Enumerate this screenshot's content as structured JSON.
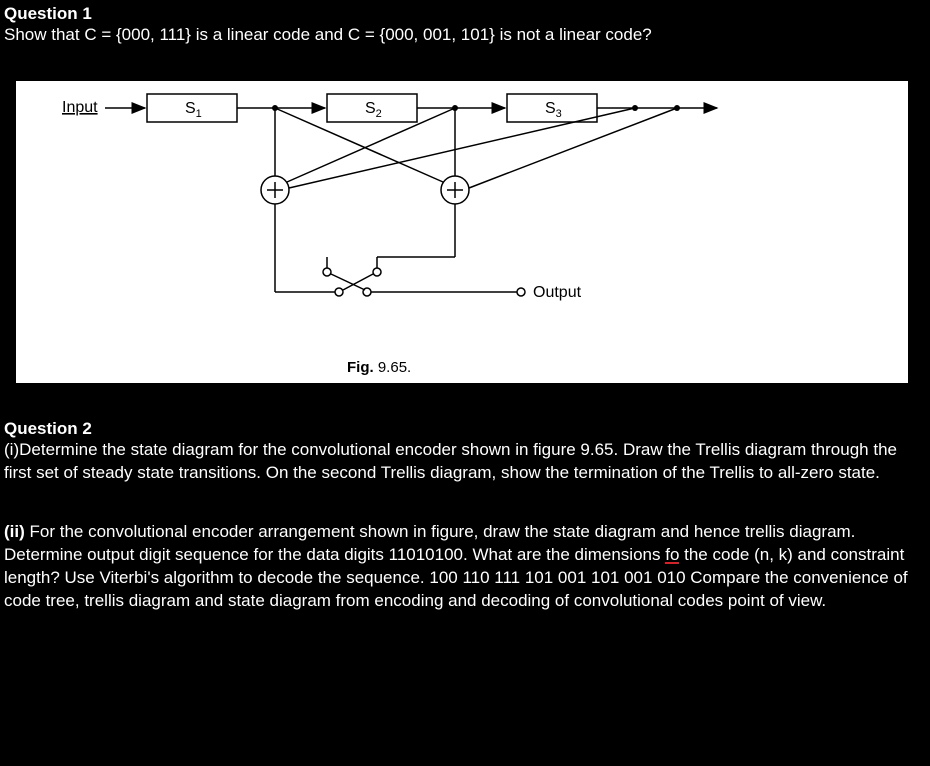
{
  "q1": {
    "title": "Question 1",
    "body": "Show that C = {000, 111} is a linear code and C = {000, 001, 101} is not a linear code?"
  },
  "fig": {
    "input": "Input",
    "s1": "S",
    "s1sub": "1",
    "s2": "S",
    "s2sub": "2",
    "s3": "S",
    "s3sub": "3",
    "output": "Output",
    "caption_b": "Fig.",
    "caption_n": " 9.65."
  },
  "q2": {
    "title": "Question 2",
    "part_i_pre": "(i)",
    "part_i": "Determine the state diagram for the convolutional encoder shown in figure 9.65.  Draw the Trellis diagram through the first set of steady state transitions. On the second Trellis  diagram, show the termination of the Trellis to all-zero state.",
    "part_ii_pre": "(ii)",
    "part_ii_a": " For the convolutional encoder  arrangement shown in figure, draw the state  diagram and hence trellis diagram. Determine output  digit sequence for the data digits 11010100. What are  the dimensions ",
    "part_ii_fo": "fo",
    "part_ii_b": " the code (n, k) and constraint  length? Use Viterbi's algorithm to decode the  sequence. 100 110 111 101 001 101 001 010  Compare the convenience of code tree, trellis  diagram and state diagram from encoding and  decoding of convolutional codes point of view."
  }
}
